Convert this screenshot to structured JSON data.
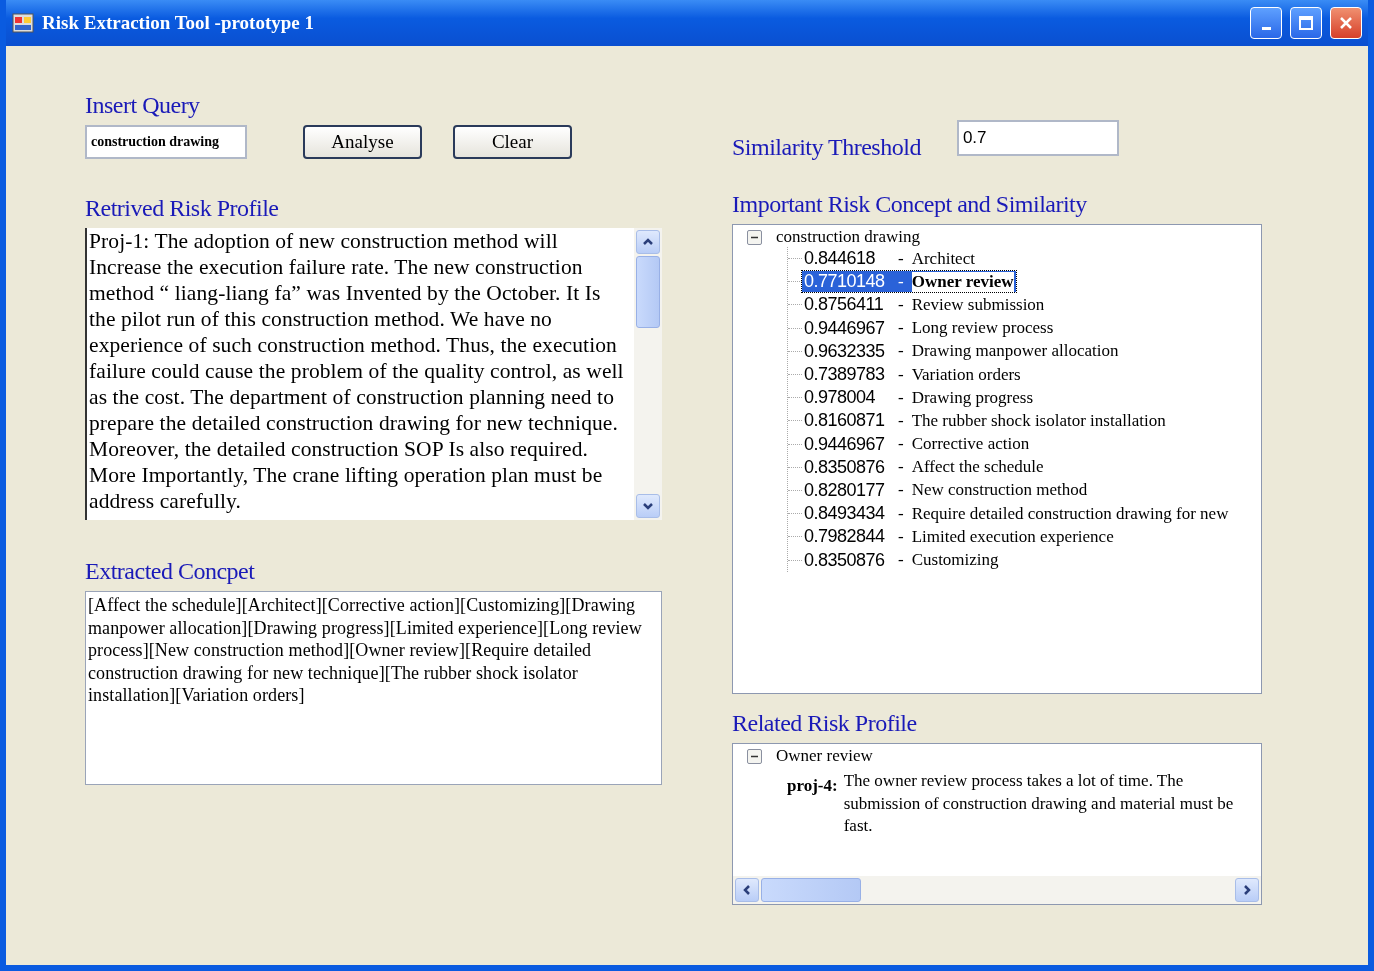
{
  "window": {
    "title": "Risk Extraction Tool -prototype 1"
  },
  "query": {
    "label": "Insert Query",
    "value": "construction drawing"
  },
  "buttons": [
    "Analyse",
    "Clear"
  ],
  "threshold": {
    "label": "Similarity Threshold",
    "value": "0.7"
  },
  "retrieved": {
    "title": "Retrived Risk Profile",
    "text": "Proj-1: The adoption of new construction method will Increase the execution failure rate. The new construction method “  liang-liang fa”   was Invented by the October. It Is the pilot run of this  construction method. We have no experience of such construction method. Thus, the execution failure could cause the problem of the quality control, as well as the cost. The department of construction planning need to prepare the detailed construction drawing for new technique. Moreover, the detailed construction SOP Is also required. More Importantly, The crane lifting operation plan must be address carefully."
  },
  "extracted": {
    "title": "Extracted Concpet",
    "text": "[Affect the schedule][Architect][Corrective action][Customizing][Drawing manpower allocation][Drawing progress][Limited experience][Long review process][New construction method][Owner review][Require detailed construction drawing for new technique][The rubber shock isolator installation][Variation orders]"
  },
  "concepts": {
    "title": "Important Risk Concept and Similarity",
    "root": "construction drawing",
    "expanded": true,
    "items": [
      {
        "score": "0.844618",
        "separator": "-",
        "concept": "Architect",
        "selected": false
      },
      {
        "score": "0.7710148",
        "separator": "-",
        "concept": "Owner review",
        "selected": true
      },
      {
        "score": "0.8756411",
        "separator": "-",
        "concept": "Review submission",
        "selected": false
      },
      {
        "score": "0.9446967",
        "separator": "-",
        "concept": "Long review process",
        "selected": false
      },
      {
        "score": "0.9632335",
        "separator": "-",
        "concept": "Drawing manpower allocation",
        "selected": false
      },
      {
        "score": "0.7389783",
        "separator": "-",
        "concept": "Variation orders",
        "selected": false
      },
      {
        "score": "0.978004",
        "separator": "-",
        "concept": "Drawing progress",
        "selected": false
      },
      {
        "score": "0.8160871",
        "separator": "-",
        "concept": "The rubber shock isolator installation",
        "selected": false
      },
      {
        "score": "0.9446967",
        "separator": "-",
        "concept": "Corrective action",
        "selected": false
      },
      {
        "score": "0.8350876",
        "separator": "-",
        "concept": "Affect the schedule",
        "selected": false
      },
      {
        "score": "0.8280177",
        "separator": "-",
        "concept": "New construction method",
        "selected": false
      },
      {
        "score": "0.8493434",
        "separator": "-",
        "concept": "Require detailed construction drawing for new",
        "selected": false
      },
      {
        "score": "0.7982844",
        "separator": "-",
        "concept": "Limited execution experience",
        "selected": false
      },
      {
        "score": "0.8350876",
        "separator": "-",
        "concept": "Customizing",
        "selected": false
      }
    ]
  },
  "related": {
    "title": "Related Risk Profile",
    "root": "Owner review",
    "expanded": true,
    "children": [
      {
        "label": "proj-4:",
        "text": "The owner review process takes a lot of time. The submission of construction drawing and material must be fast."
      }
    ]
  }
}
